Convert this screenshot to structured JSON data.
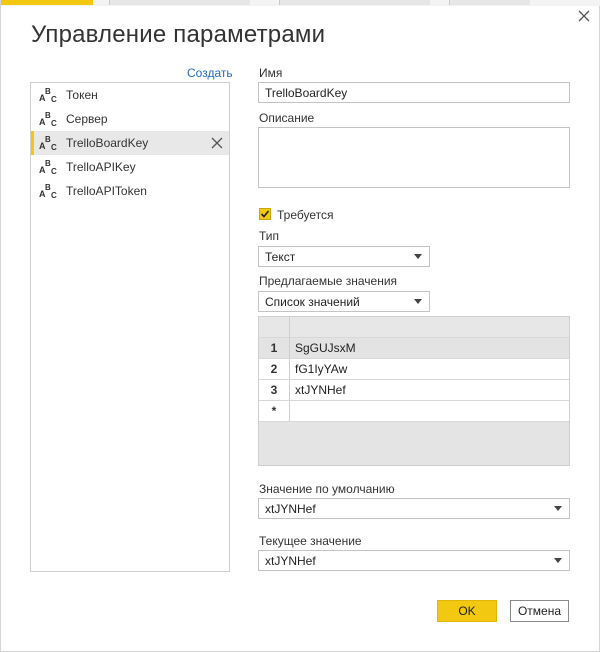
{
  "dialog": {
    "title": "Управление параметрами",
    "create_link": "Создать"
  },
  "parameters": [
    {
      "name": "Токен",
      "icon": "abc-text-type-icon",
      "selected": false
    },
    {
      "name": "Сервер",
      "icon": "abc-text-type-icon",
      "selected": false
    },
    {
      "name": "TrelloBoardKey",
      "icon": "abc-text-type-icon",
      "selected": true
    },
    {
      "name": "TrelloAPIKey",
      "icon": "abc-text-type-icon",
      "selected": false
    },
    {
      "name": "TrelloAPIToken",
      "icon": "abc-text-type-icon",
      "selected": false
    }
  ],
  "form": {
    "name_label": "Имя",
    "name_value": "TrelloBoardKey",
    "description_label": "Описание",
    "description_value": "",
    "required_label": "Требуется",
    "required_checked": true,
    "type_label": "Тип",
    "type_value": "Текст",
    "suggested_label": "Предлагаемые значения",
    "suggested_value": "Список значений",
    "values_table": {
      "rows": [
        {
          "num": "1",
          "value": "SgGUJsxM"
        },
        {
          "num": "2",
          "value": "fG1IyYAw"
        },
        {
          "num": "3",
          "value": "xtJYNHef"
        }
      ],
      "new_row_marker": "*"
    },
    "default_label": "Значение по умолчанию",
    "default_value": "xtJYNHef",
    "current_label": "Текущее значение",
    "current_value": "xtJYNHef"
  },
  "buttons": {
    "ok": "OK",
    "cancel": "Отмена"
  },
  "colors": {
    "accent": "#f2c811",
    "link": "#1f6bb8",
    "selection": "#e8e8e8"
  }
}
